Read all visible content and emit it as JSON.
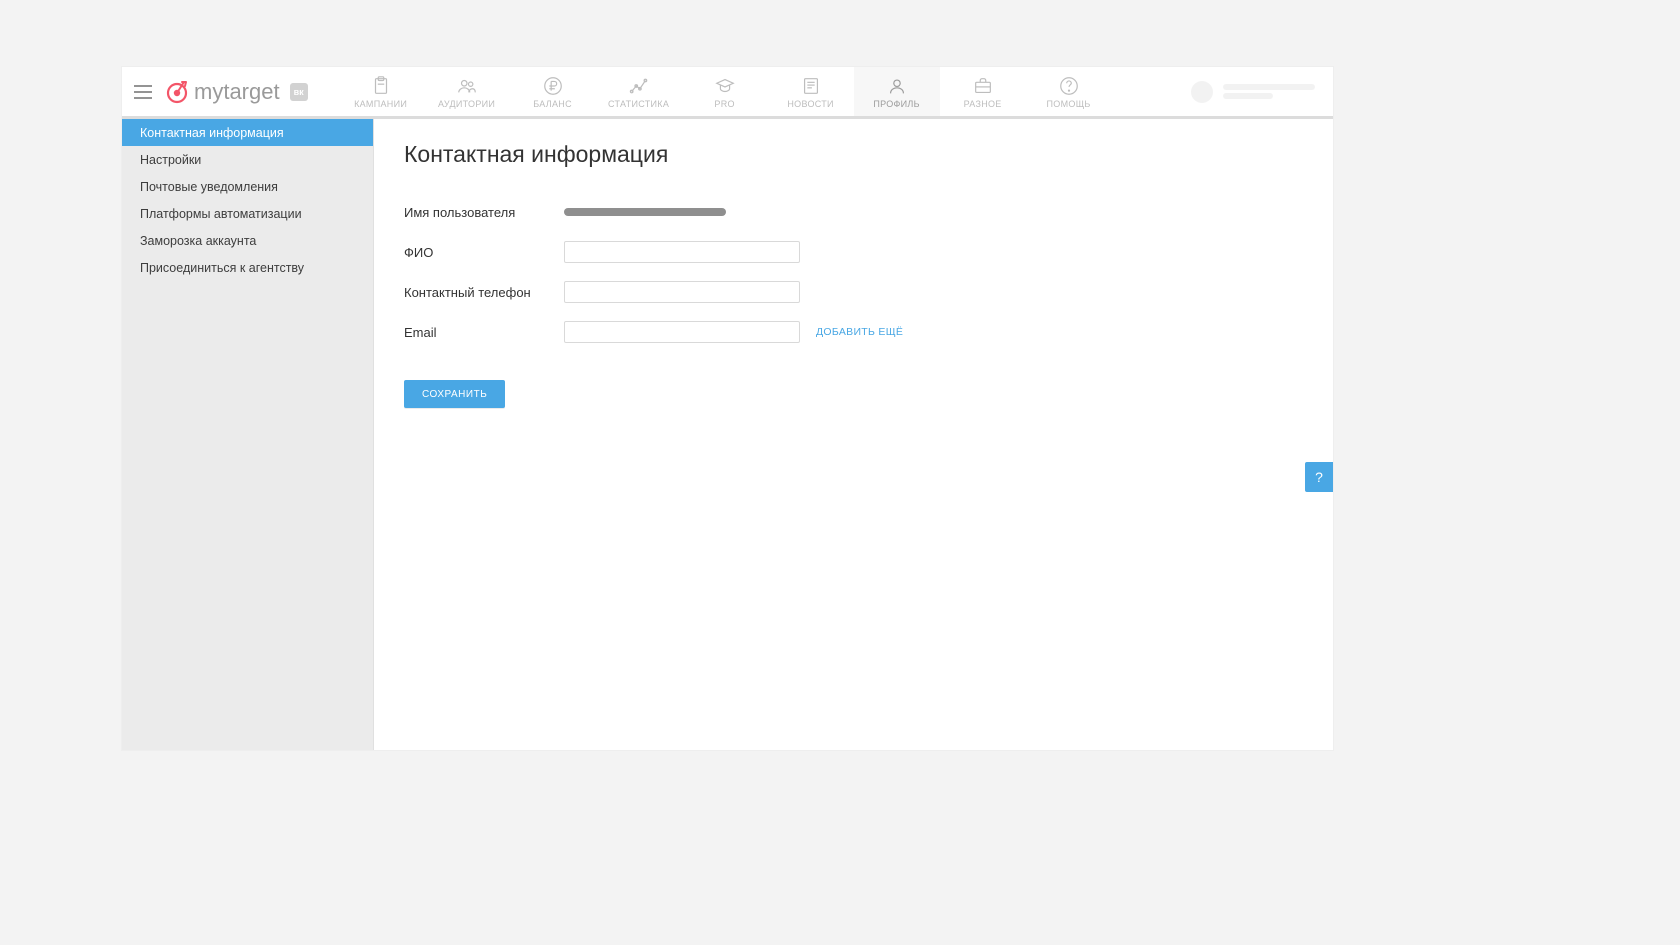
{
  "brand": {
    "name": "mytarget",
    "badge": "вк"
  },
  "nav": {
    "items": [
      {
        "key": "campaigns",
        "label": "КАМПАНИИ",
        "icon": "clipboard-icon"
      },
      {
        "key": "audiences",
        "label": "АУДИТОРИИ",
        "icon": "users-icon"
      },
      {
        "key": "balance",
        "label": "БАЛАНС",
        "icon": "ruble-icon"
      },
      {
        "key": "statistics",
        "label": "СТАТИСТИКА",
        "icon": "chart-icon"
      },
      {
        "key": "pro",
        "label": "PRO",
        "icon": "graduation-icon"
      },
      {
        "key": "news",
        "label": "НОВОСТИ",
        "icon": "newspaper-icon"
      },
      {
        "key": "profile",
        "label": "ПРОФИЛЬ",
        "icon": "profile-icon",
        "active": true
      },
      {
        "key": "misc",
        "label": "РАЗНОЕ",
        "icon": "briefcase-icon"
      },
      {
        "key": "help",
        "label": "ПОМОЩЬ",
        "icon": "help-icon"
      }
    ]
  },
  "sidebar": {
    "items": [
      {
        "label": "Контактная информация",
        "active": true
      },
      {
        "label": "Настройки"
      },
      {
        "label": "Почтовые уведомления"
      },
      {
        "label": "Платформы автоматизации"
      },
      {
        "label": "Заморозка аккаунта"
      },
      {
        "label": "Присоединиться к агентству"
      }
    ]
  },
  "page": {
    "title": "Контактная информация",
    "fields": {
      "username_label": "Имя пользователя",
      "fullname_label": "ФИО",
      "phone_label": "Контактный телефон",
      "email_label": "Email",
      "fullname_value": "",
      "phone_value": "",
      "email_value": ""
    },
    "add_more": "ДОБАВИТЬ ЕЩЁ",
    "save": "СОХРАНИТЬ"
  },
  "float_help": "?",
  "colors": {
    "accent": "#49a7e4"
  }
}
